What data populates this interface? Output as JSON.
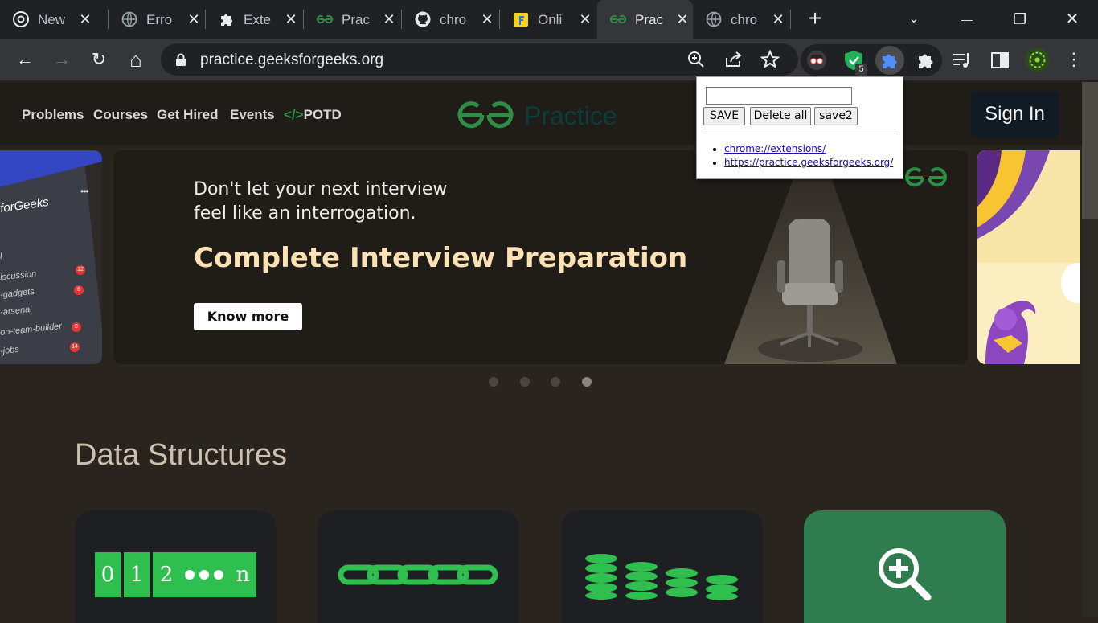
{
  "browser": {
    "tabs": [
      {
        "label": "New",
        "favicon": "chrome-icon"
      },
      {
        "label": "Erro",
        "favicon": "globe-icon"
      },
      {
        "label": "Exte",
        "favicon": "puzzle-icon"
      },
      {
        "label": "Prac",
        "favicon": "gfg-icon"
      },
      {
        "label": "chro",
        "favicon": "github-icon"
      },
      {
        "label": "Onli",
        "favicon": "flipkart-icon"
      },
      {
        "label": "Prac",
        "favicon": "gfg-icon",
        "active": true
      },
      {
        "label": "chro",
        "favicon": "globe-icon"
      }
    ],
    "new_tab_symbol": "+",
    "window_controls": {
      "dropdown": "⌄",
      "minimize": "—",
      "restore": "❐",
      "close": "✕"
    },
    "nav": {
      "back": "←",
      "forward": "→",
      "reload": "↻",
      "home": "⌂"
    },
    "address": "practice.geeksforgeeks.org",
    "extension_badge": "5",
    "menu_symbol": "⋮"
  },
  "site": {
    "nav_items": [
      "Problems",
      "Courses",
      "Get Hired",
      "Events"
    ],
    "potd_code": "</>",
    "potd_label": "POTD",
    "logo_text": "Practice",
    "sign_in": "Sign In"
  },
  "carousel": {
    "left_slide": {
      "title": "forGeeks",
      "more": "•••",
      "channels": [
        {
          "name": "l",
          "badge": ""
        },
        {
          "name": "iscussion",
          "badge": "12"
        },
        {
          "name": "-gadgets",
          "badge": "6"
        },
        {
          "name": "-arsenal",
          "badge": ""
        },
        {
          "name": "on-team-builder",
          "badge": "8"
        },
        {
          "name": "-jobs",
          "badge": "14"
        }
      ]
    },
    "main_slide": {
      "line1": "Don't let your next interview",
      "line2": "feel like an interrogation.",
      "headline": "Complete Interview Preparation",
      "button": "Know more"
    },
    "dots_count": 4,
    "active_dot": 4
  },
  "section": {
    "title": "Data Structures",
    "array_cells": [
      "0",
      "1",
      "2",
      "n"
    ]
  },
  "popup": {
    "input_value": "",
    "buttons": {
      "save": "SAVE",
      "delete_all": "Delete all",
      "save2": "save2"
    },
    "links": [
      "chrome://extensions/",
      "https://practice.geeksforgeeks.org/"
    ]
  },
  "colors": {
    "gfg_green": "#2f8d46",
    "headline": "#fbe2b4",
    "page_bg": "#2a241f"
  }
}
